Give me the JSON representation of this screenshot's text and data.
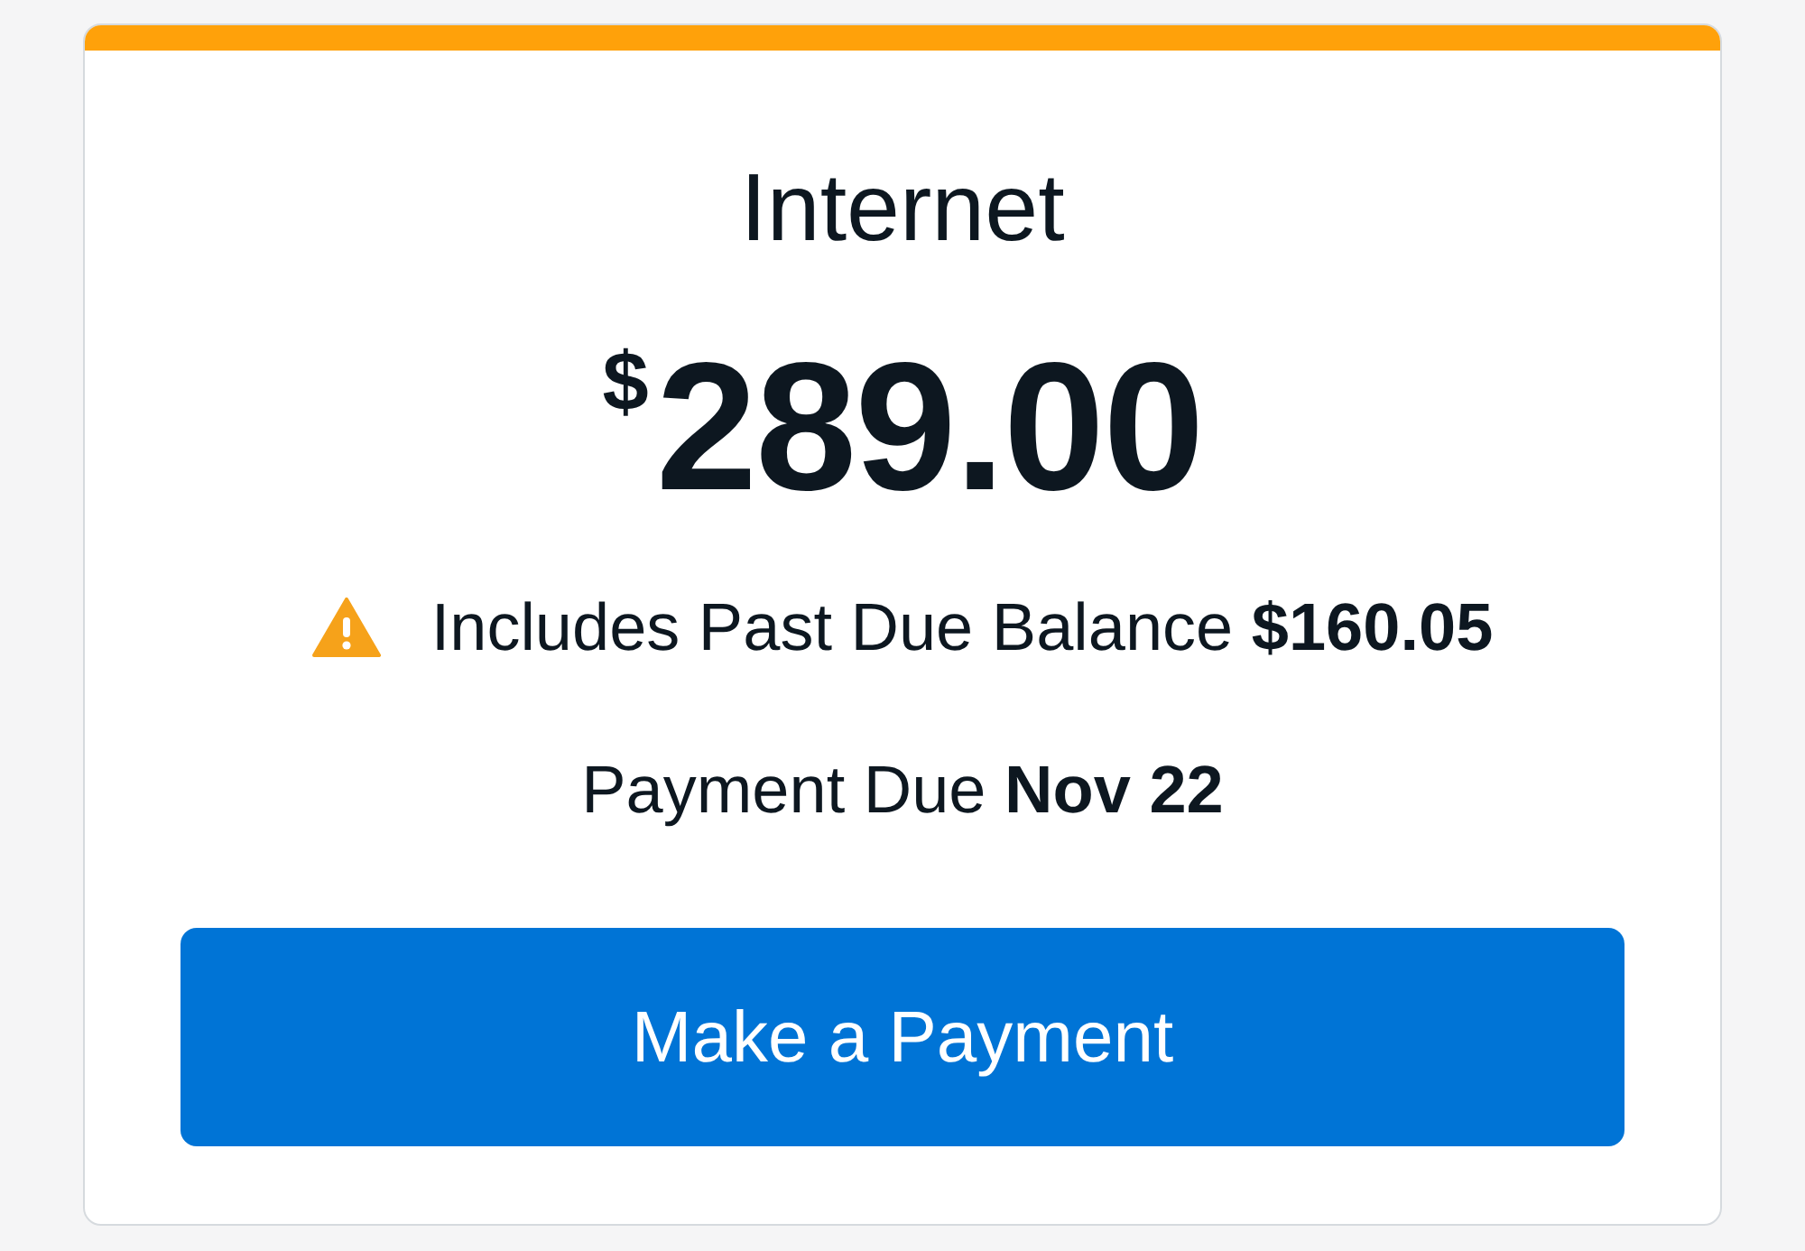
{
  "card": {
    "title": "Internet",
    "amount": {
      "currency": "$",
      "value": "289.00"
    },
    "notice": {
      "text": "Includes Past Due Balance **$160.05**"
    },
    "due": {
      "text": "Payment Due **Nov 22**"
    },
    "button": {
      "label": "Make a Payment"
    }
  }
}
